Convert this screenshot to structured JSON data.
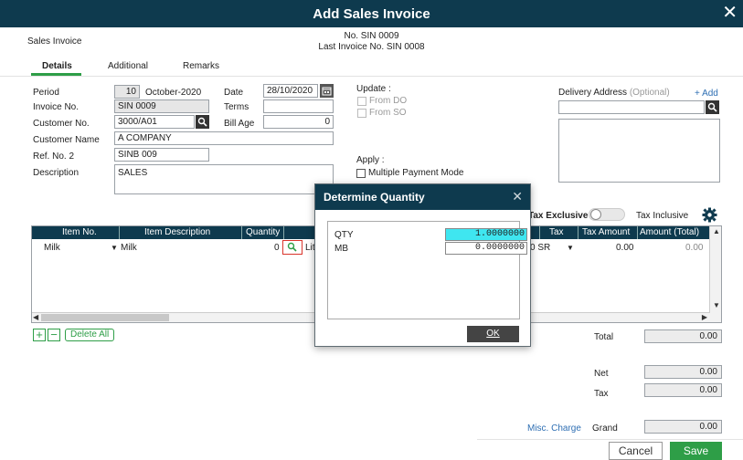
{
  "window": {
    "title": "Add Sales Invoice",
    "close_glyph": "✕"
  },
  "header": {
    "module": "Sales Invoice",
    "doc_no": "No. SIN 0009",
    "last_invoice": "Last Invoice No. SIN 0008"
  },
  "tabs": [
    {
      "label": "Details"
    },
    {
      "label": "Additional"
    },
    {
      "label": "Remarks"
    }
  ],
  "form": {
    "period_label": "Period",
    "period_num": "10",
    "period_text": "October-2020",
    "date_label": "Date",
    "date_value": "28/10/2020",
    "invoice_label": "Invoice No.",
    "invoice_value": "SIN 0009",
    "terms_label": "Terms",
    "terms_value": "",
    "customer_no_label": "Customer No.",
    "customer_no_value": "3000/A01",
    "bill_age_label": "Bill Age",
    "bill_age_value": "0",
    "customer_name_label": "Customer Name",
    "customer_name_value": "A COMPANY",
    "ref_label": "Ref. No. 2",
    "ref_value": "SINB 009",
    "desc_label": "Description",
    "desc_value": "SALES"
  },
  "update": {
    "label": "Update :",
    "from_do": "From DO",
    "from_so": "From SO"
  },
  "apply": {
    "label": "Apply :",
    "multiple_payment": "Multiple Payment Mode"
  },
  "delivery": {
    "label": "Delivery Address",
    "optional": "(Optional)",
    "add": "+ Add"
  },
  "tax_toggle": {
    "exclusive": "Tax Exclusive",
    "inclusive": "Tax Inclusive"
  },
  "grid": {
    "columns": [
      "Item No.",
      "Item Description",
      "Quantity",
      "",
      "Tax",
      "Tax Amount",
      "Amount (Total)"
    ],
    "rows": [
      {
        "item_no": "Milk",
        "desc": "Milk",
        "qty": "0",
        "tax_code": "0 SR",
        "tax_amount": "0.00",
        "amount": "0.00"
      }
    ],
    "cut_text": "Lit"
  },
  "grid_buttons": {
    "add": "+",
    "remove": "−",
    "delete_all": "Delete All"
  },
  "totals": {
    "total_label": "Total",
    "total_value": "0.00",
    "net_label": "Net",
    "net_value": "0.00",
    "tax_label": "Tax",
    "tax_value": "0.00",
    "misc_charge": "Misc. Charge",
    "grand_label": "Grand",
    "grand_value": "0.00"
  },
  "buttons": {
    "cancel": "Cancel",
    "save": "Save"
  },
  "dialog": {
    "title": "Determine Quantity",
    "close_glyph": "✕",
    "qty_label": "QTY",
    "qty_value": "1.0000000",
    "mb_label": "MB",
    "mb_value": "0.0000000",
    "ok": "OK"
  },
  "colors": {
    "header_bg": "#0e3a4e",
    "accent_green": "#2e9e47",
    "link_blue": "#2f6fb3",
    "highlight_cyan": "#3fe6f0",
    "search_highlight": "#d9342b"
  },
  "icons": [
    "close-icon",
    "search-icon",
    "calendar-icon",
    "gear-icon",
    "dropdown-arrow-icon"
  ]
}
